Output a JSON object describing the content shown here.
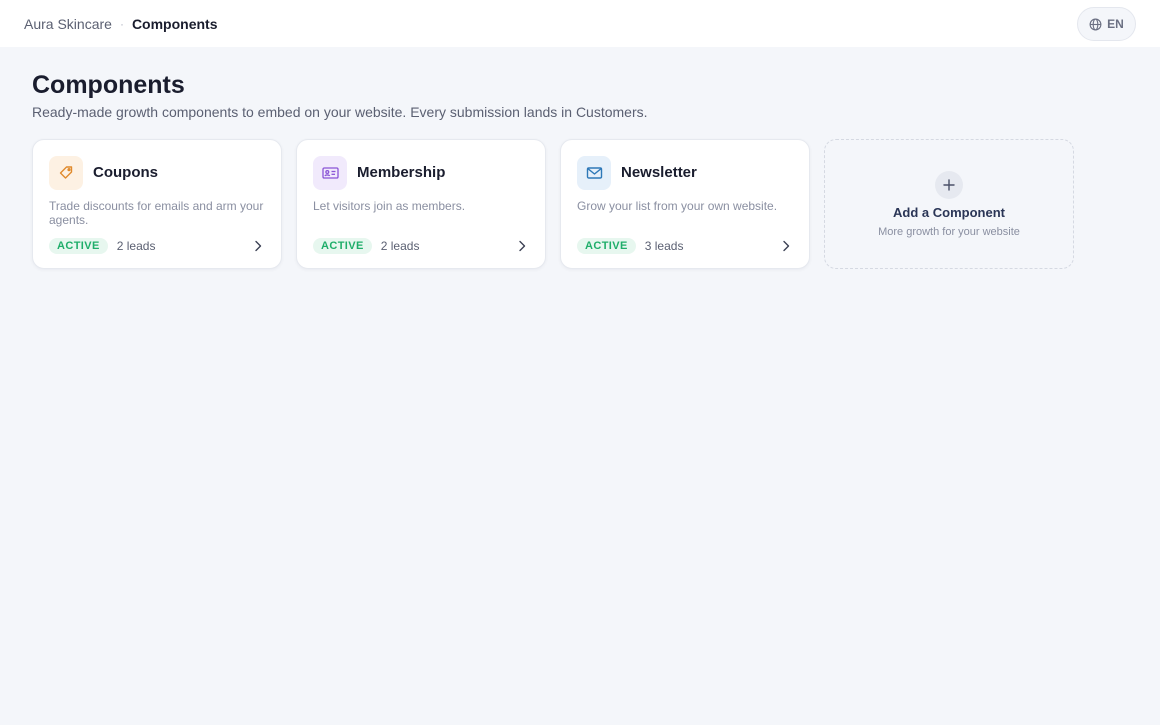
{
  "breadcrumb": {
    "parent": "Aura Skincare",
    "separator": "·",
    "current": "Components"
  },
  "language": {
    "label": "EN",
    "icon": "globe-icon"
  },
  "page": {
    "title": "Components",
    "subtitle": "Ready-made growth components to embed on your website. Every submission lands in Customers."
  },
  "cards": [
    {
      "title": "Coupons",
      "icon": "tag-icon",
      "accent": "#e08a2c",
      "icon_bg": "#fdf1e3",
      "description": "Trade discounts for emails and arm your agents.",
      "status": "ACTIVE",
      "leads": "2 leads"
    },
    {
      "title": "Membership",
      "icon": "id-card-icon",
      "accent": "#8a55d6",
      "icon_bg": "#f1eafc",
      "description": "Let visitors join as members.",
      "status": "ACTIVE",
      "leads": "2 leads"
    },
    {
      "title": "Newsletter",
      "icon": "mail-icon",
      "accent": "#2f79b8",
      "icon_bg": "#e6f0fa",
      "description": "Grow your list from your own website.",
      "status": "ACTIVE",
      "leads": "3 leads"
    }
  ],
  "add_card": {
    "title": "Add a Component",
    "subtitle": "More growth for your website",
    "icon": "plus-icon"
  },
  "colors": {
    "active_badge_bg": "#e7f7ef",
    "active_badge_text": "#1fae6a",
    "page_bg": "#f4f6fa"
  }
}
